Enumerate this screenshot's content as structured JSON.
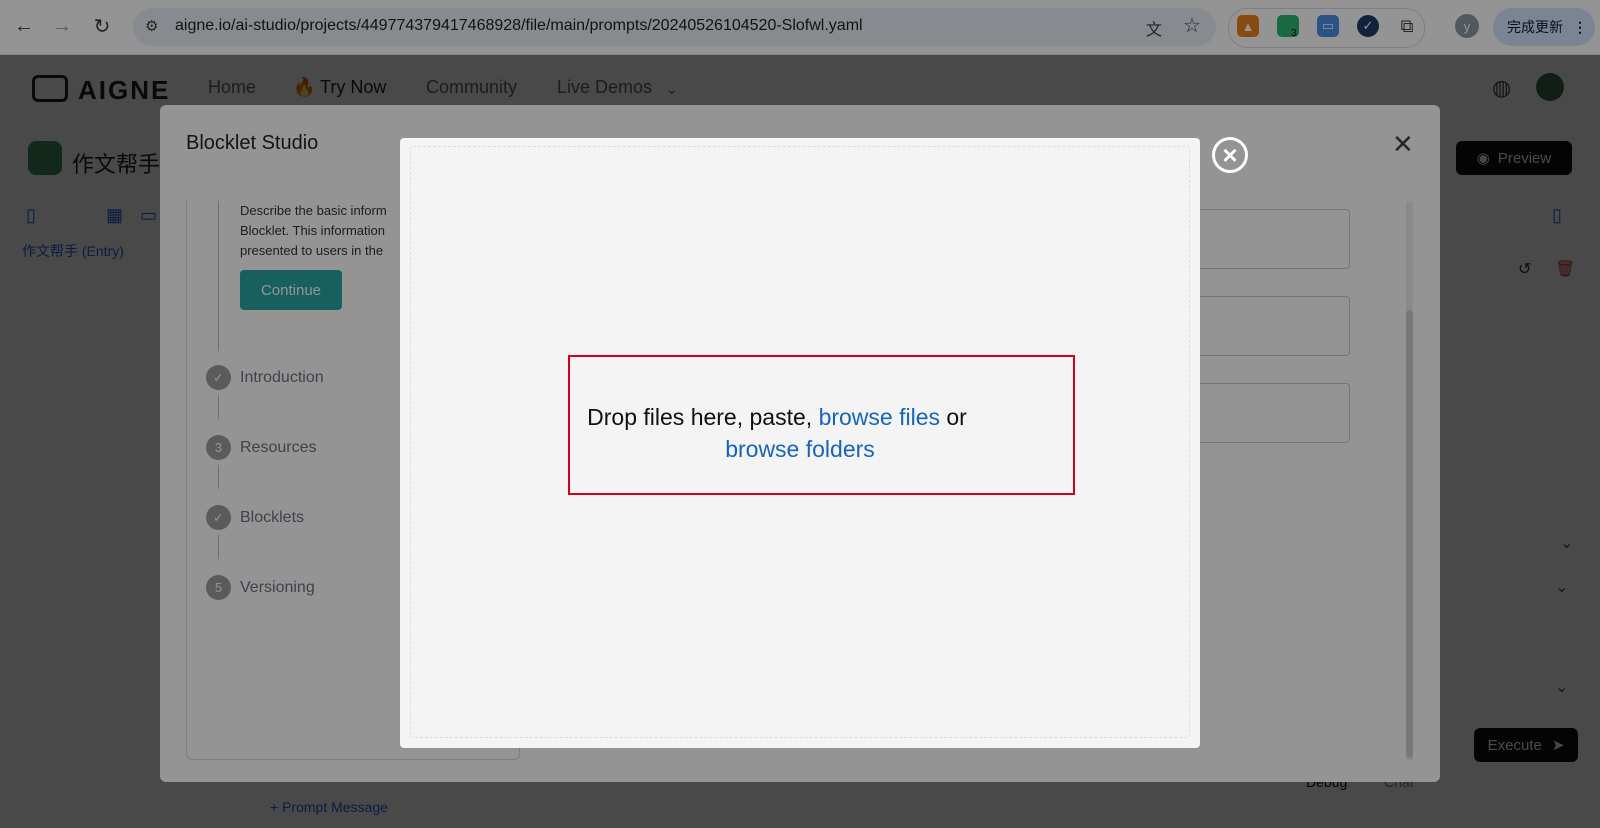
{
  "browser": {
    "url": "aigne.io/ai-studio/projects/449774379417468928/file/main/prompts/20240526104520-Slofwl.yaml",
    "profile_initial": "y",
    "update_label": "完成更新",
    "extension_badge": "3"
  },
  "site": {
    "logo_text": "AIGNE",
    "nav": [
      "Home",
      "Try Now",
      "Community",
      "Live Demos"
    ],
    "project_title": "作文帮手",
    "preview_label": "Preview",
    "entry_label": "作文帮手 (Entry)",
    "execute_label": "Execute",
    "prompt_message_label": "Prompt Message",
    "debug_tab": "Debug",
    "chat_tab": "Chat"
  },
  "studio": {
    "title": "Blocklet Studio",
    "description": "Describe the basic inform Blocklet. This information presented to users in the",
    "continue_label": "Continue",
    "steps": [
      {
        "marker": "✓",
        "label": "Introduction"
      },
      {
        "marker": "3",
        "label": "Resources"
      },
      {
        "marker": "✓",
        "label": "Blocklets"
      },
      {
        "marker": "5",
        "label": "Versioning"
      }
    ]
  },
  "uploader": {
    "text_before": "Drop files here, paste, ",
    "browse_files": "browse files",
    "text_or": " or",
    "browse_folders": "browse folders",
    "close_symbol": "×"
  },
  "colors": {
    "link": "#1565c0",
    "highlight": "#d0021b",
    "continue": "#2aa6a6"
  }
}
